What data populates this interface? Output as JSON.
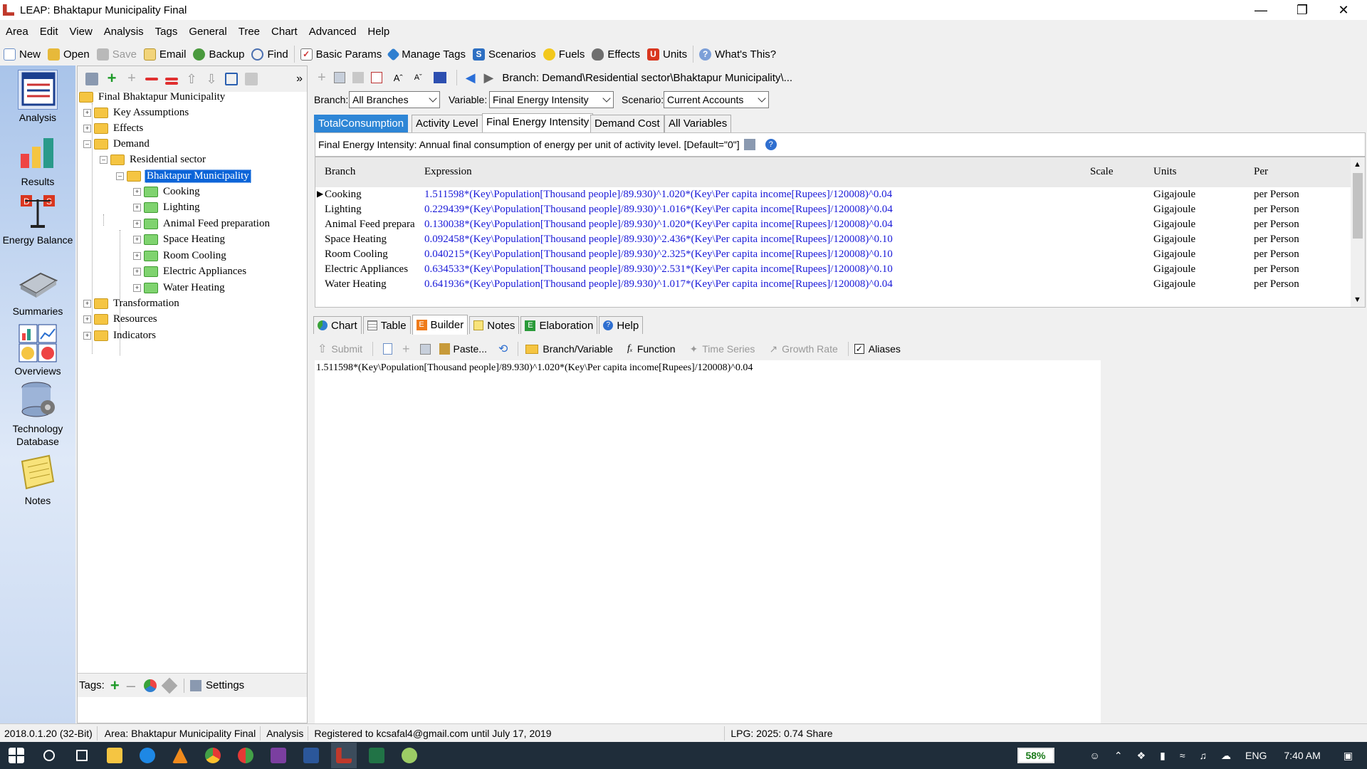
{
  "window": {
    "title": "LEAP: Bhaktapur Municipality Final"
  },
  "menu": [
    "Area",
    "Edit",
    "View",
    "Analysis",
    "Tags",
    "General",
    "Tree",
    "Chart",
    "Advanced",
    "Help"
  ],
  "toolbar": {
    "new": "New",
    "open": "Open",
    "save": "Save",
    "email": "Email",
    "backup": "Backup",
    "find": "Find",
    "basic_params": "Basic Params",
    "manage_tags": "Manage Tags",
    "scenarios": "Scenarios",
    "fuels": "Fuels",
    "effects": "Effects",
    "units": "Units",
    "whats_this": "What's This?"
  },
  "left_nav": [
    {
      "label": "Analysis"
    },
    {
      "label": "Results"
    },
    {
      "label": "Energy Balance"
    },
    {
      "label": "Summaries"
    },
    {
      "label": "Overviews"
    },
    {
      "label": "Technology Database"
    },
    {
      "label": "Notes"
    }
  ],
  "tree": {
    "root": "Final Bhaktapur Municipality",
    "key_assumptions": "Key Assumptions",
    "effects": "Effects",
    "demand": "Demand",
    "residential": "Residential sector",
    "bhaktapur": "Bhaktapur Municipality",
    "children": [
      "Cooking",
      "Lighting",
      "Animal Feed preparation",
      "Space  Heating",
      "Room Cooling",
      "Electric Appliances",
      "Water Heating"
    ],
    "transformation": "Transformation",
    "resources": "Resources",
    "indicators": "Indicators"
  },
  "tags_bar": {
    "tags_label": "Tags:",
    "settings": "Settings"
  },
  "branch_path": "Branch: Demand\\Residential sector\\Bhaktapur Municipality\\...",
  "selectors": {
    "branch_label": "Branch:",
    "branch_value": "All Branches",
    "variable_label": "Variable:",
    "variable_value": "Final Energy Intensity",
    "scenario_label": "Scenario:",
    "scenario_value": "Current Accounts"
  },
  "variable_tabs": [
    "TotalConsumption",
    "Activity Level",
    "Final Energy Intensity",
    "Demand Cost",
    "All Variables"
  ],
  "description": "Final Energy Intensity: Annual final consumption of energy per unit of activity level. [Default=\"0\"]",
  "grid": {
    "headers": {
      "branch": "Branch",
      "expression": "Expression",
      "scale": "Scale",
      "units": "Units",
      "per": "Per"
    },
    "rows": [
      {
        "branch": "Cooking",
        "expression": "1.511598*(Key\\Population[Thousand people]/89.930)^1.020*(Key\\Per capita income[Rupees]/120008)^0.04",
        "units": "Gigajoule",
        "per": "per Person"
      },
      {
        "branch": "Lighting",
        "expression": "0.229439*(Key\\Population[Thousand people]/89.930)^1.016*(Key\\Per capita income[Rupees]/120008)^0.04",
        "units": "Gigajoule",
        "per": "per Person"
      },
      {
        "branch": "Animal Feed prepara",
        "expression": "0.130038*(Key\\Population[Thousand people]/89.930)^1.020*(Key\\Per capita income[Rupees]/120008)^0.04",
        "units": "Gigajoule",
        "per": "per Person"
      },
      {
        "branch": "Space  Heating",
        "expression": "0.092458*(Key\\Population[Thousand people]/89.930)^2.436*(Key\\Per capita income[Rupees]/120008)^0.10",
        "units": "Gigajoule",
        "per": "per Person"
      },
      {
        "branch": "Room Cooling",
        "expression": "0.040215*(Key\\Population[Thousand people]/89.930)^2.325*(Key\\Per capita income[Rupees]/120008)^0.10",
        "units": "Gigajoule",
        "per": "per Person"
      },
      {
        "branch": "Electric Appliances",
        "expression": "0.634533*(Key\\Population[Thousand people]/89.930)^2.531*(Key\\Per capita income[Rupees]/120008)^0.10",
        "units": "Gigajoule",
        "per": "per Person"
      },
      {
        "branch": "Water Heating",
        "expression": "0.641936*(Key\\Population[Thousand people]/89.930)^1.017*(Key\\Per capita income[Rupees]/120008)^0.04",
        "units": "Gigajoule",
        "per": "per Person"
      }
    ]
  },
  "bottom_tabs": [
    "Chart",
    "Table",
    "Builder",
    "Notes",
    "Elaboration",
    "Help"
  ],
  "builder_toolbar": {
    "submit": "Submit",
    "paste": "Paste...",
    "branch_variable": "Branch/Variable",
    "function": "Function",
    "time_series": "Time Series",
    "growth_rate": "Growth Rate",
    "aliases": "Aliases"
  },
  "builder_expression": "1.511598*(Key\\Population[Thousand people]/89.930)^1.020*(Key\\Per capita income[Rupees]/120008)^0.04",
  "status": {
    "version": "2018.0.1.20 (32-Bit)",
    "area": "Area: Bhaktapur Municipality Final",
    "view": "Analysis",
    "registered": "Registered to kcsafal4@gmail.com until July 17, 2019",
    "lpg": "LPG: 2025: 0.74 Share"
  },
  "taskbar": {
    "battery": "58%",
    "lang": "ENG",
    "time": "7:40 AM"
  },
  "colors": {
    "accent": "#2e86d6",
    "selection": "#0a64d8",
    "expression": "#1a1ad8",
    "taskbar": "#1f2d3a"
  }
}
